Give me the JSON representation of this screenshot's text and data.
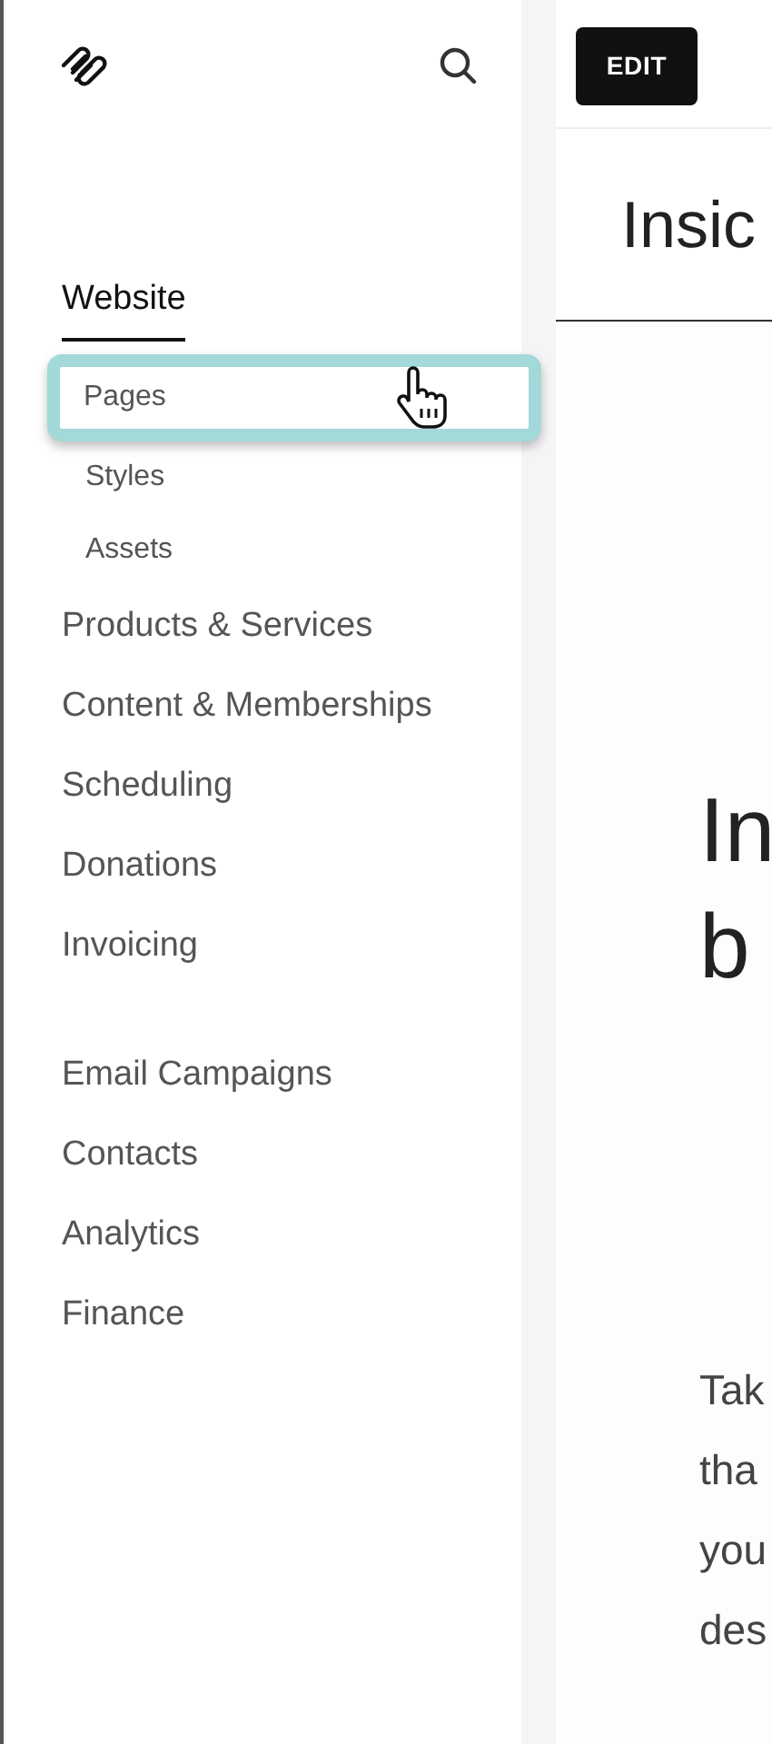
{
  "nav_groups": [
    [
      {
        "label": "Website",
        "selected": true,
        "children": [
          {
            "label": "Pages",
            "highlighted": true
          },
          {
            "label": "Styles",
            "highlighted": false
          },
          {
            "label": "Assets",
            "highlighted": false
          }
        ]
      },
      {
        "label": "Products & Services",
        "selected": false
      },
      {
        "label": "Content & Memberships",
        "selected": false
      },
      {
        "label": "Scheduling",
        "selected": false
      },
      {
        "label": "Donations",
        "selected": false
      },
      {
        "label": "Invoicing",
        "selected": false
      }
    ],
    [
      {
        "label": "Email Campaigns",
        "selected": false
      },
      {
        "label": "Contacts",
        "selected": false
      },
      {
        "label": "Analytics",
        "selected": false
      },
      {
        "label": "Finance",
        "selected": false
      }
    ]
  ],
  "edit_button": "EDIT",
  "page_title": "Insic",
  "heading_lines": [
    "In",
    "b"
  ],
  "body_lines": [
    "Tak",
    "tha",
    "you",
    "des"
  ]
}
